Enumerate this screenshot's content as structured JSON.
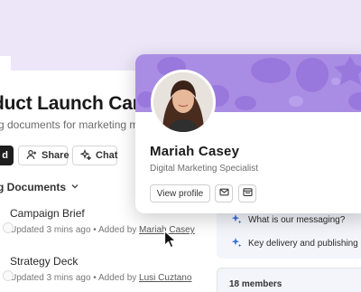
{
  "page": {
    "title": "duct Launch Can",
    "subtitle": "g documents for marketing me"
  },
  "toolbar": {
    "dark_label": "d",
    "share_label": "Share",
    "chat_label": "Chat"
  },
  "section": {
    "title": "g Documents"
  },
  "documents": [
    {
      "title": "Campaign Brief",
      "meta_prefix": "Updated 3 mins ago  •  Added by ",
      "author": "Mariah Casey"
    },
    {
      "title": "Strategy Deck",
      "meta_prefix": "Updated 3 mins ago  •  Added by ",
      "author": "Lusi Cuztano"
    }
  ],
  "suggestions": [
    {
      "text": "What is our messaging?"
    },
    {
      "text": "Key delivery and publishing da"
    }
  ],
  "members": {
    "label": "18 members"
  },
  "profile_card": {
    "name": "Mariah Casey",
    "role": "Digital Marketing Specialist",
    "view_profile_label": "View profile"
  },
  "colors": {
    "banner": "#a98de4",
    "top_band": "#ece6f8",
    "sparkle": "#3b6fd8"
  },
  "icons": {
    "share": "person-add-icon",
    "chat": "sparkle-icon",
    "mail": "envelope-icon",
    "calendar": "calendar-icon",
    "suggestion": "sparkle-icon",
    "section_toggle": "chevron-down-icon"
  }
}
